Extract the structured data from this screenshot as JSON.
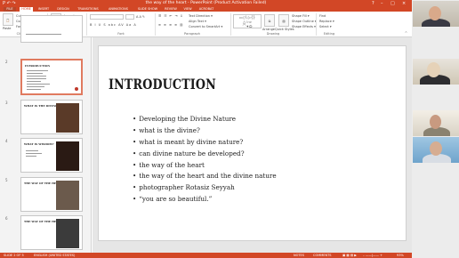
{
  "window": {
    "title": "the way of the heart - PowerPoint (Product Activation Failed)",
    "controls": [
      "?",
      "–",
      "□",
      "×"
    ],
    "quick_access": "P ↶ ↷"
  },
  "tabs": [
    "FILE",
    "HOME",
    "INSERT",
    "DESIGN",
    "TRANSITIONS",
    "ANIMATIONS",
    "SLIDE SHOW",
    "REVIEW",
    "VIEW",
    "ACROBAT"
  ],
  "active_tab": "HOME",
  "ribbon": {
    "clipboard": {
      "paste": "Paste",
      "cut": "Cut",
      "copy": "Copy ▾",
      "format_painter": "Format Painter",
      "label": "Clipboard"
    },
    "slides": {
      "new_slide": "New Slide ▾",
      "layout": "Layout ▾",
      "reset": "Reset",
      "section": "Section ▾",
      "label": "Slides"
    },
    "font": {
      "name": "",
      "size": "",
      "label": "Font",
      "buttons": "B I U S abc AV Aa A"
    },
    "paragraph": {
      "label": "Paragraph",
      "text_direction": "Text Direction ▾",
      "align_text": "Align Text ▾",
      "smartart": "Convert to SmartArt ▾"
    },
    "drawing": {
      "label": "Drawing",
      "arrange": "Arrange",
      "quick_styles": "Quick Styles",
      "shape_fill": "Shape Fill ▾",
      "shape_outline": "Shape Outline ▾",
      "shape_effects": "Shape Effects ▾"
    },
    "editing": {
      "label": "Editing",
      "find": "Find",
      "replace": "Replace ▾",
      "select": "Select ▾"
    }
  },
  "slides": [
    {
      "num": "1",
      "title": ""
    },
    {
      "num": "2",
      "title": "INTRODUCTION"
    },
    {
      "num": "3",
      "title": "WHAT IS THE DIVINE?"
    },
    {
      "num": "4",
      "title": "WHAT IS WISDOM?"
    },
    {
      "num": "5",
      "title": "THE WAY OF THE HEART"
    },
    {
      "num": "6",
      "title": "THE WAY OF THE HEART"
    }
  ],
  "current_slide": {
    "title": "INTRODUCTION",
    "bullets": [
      "Developing the Divine Nature",
      "what is the divine?",
      "what is meant by divine nature?",
      "can divine nature be developed?",
      "the way of the heart",
      "the way of the heart and the divine nature",
      "photographer Rotasiz Seyyah",
      "“you are so beautiful.”"
    ]
  },
  "status": {
    "slide_of": "SLIDE 2 OF 5",
    "language": "ENGLISH (UNITED STATES)",
    "notes": "NOTES",
    "comments": "COMMENTS",
    "zoom": "93%"
  },
  "colors": {
    "accent": "#d24726",
    "record": "#c0392b"
  }
}
